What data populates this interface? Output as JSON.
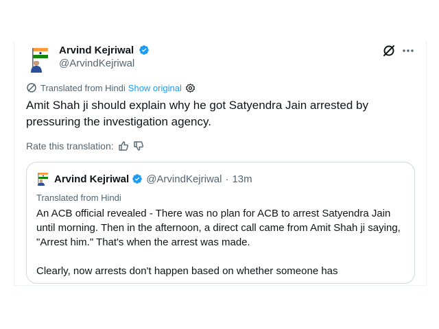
{
  "author": {
    "name": "Arvind Kejriwal",
    "handle": "@ArvindKejriwal"
  },
  "translation": {
    "label": "Translated from Hindi",
    "show_original": "Show original"
  },
  "tweet": {
    "text": "Amit Shah ji should explain why he got Satyendra Jain arrested by pressuring the investigation agency."
  },
  "rate": {
    "label": "Rate this translation:"
  },
  "quote": {
    "name": "Arvind Kejriwal",
    "handle": "@ArvindKejriwal",
    "separator": "·",
    "time": "13m",
    "translated_label": "Translated from Hindi",
    "paragraph1": "An ACB official revealed - There was no plan for ACB to arrest Satyendra Jain until morning. Then in the afternoon, a direct call came from Amit Shah ji saying, \"Arrest him.\" That's when the arrest was made.",
    "paragraph2": "Clearly, now arrests don't happen based on whether someone has"
  },
  "colors": {
    "text": "#0f1419",
    "secondary": "#536471",
    "accent": "#1d9bf0",
    "border": "#cfd9de"
  },
  "icons": [
    "avatar-flag",
    "verified-badge-icon",
    "grok-icon",
    "more-icon",
    "translate-icon",
    "settings-gear-icon",
    "thumbs-up-icon",
    "thumbs-down-icon"
  ]
}
